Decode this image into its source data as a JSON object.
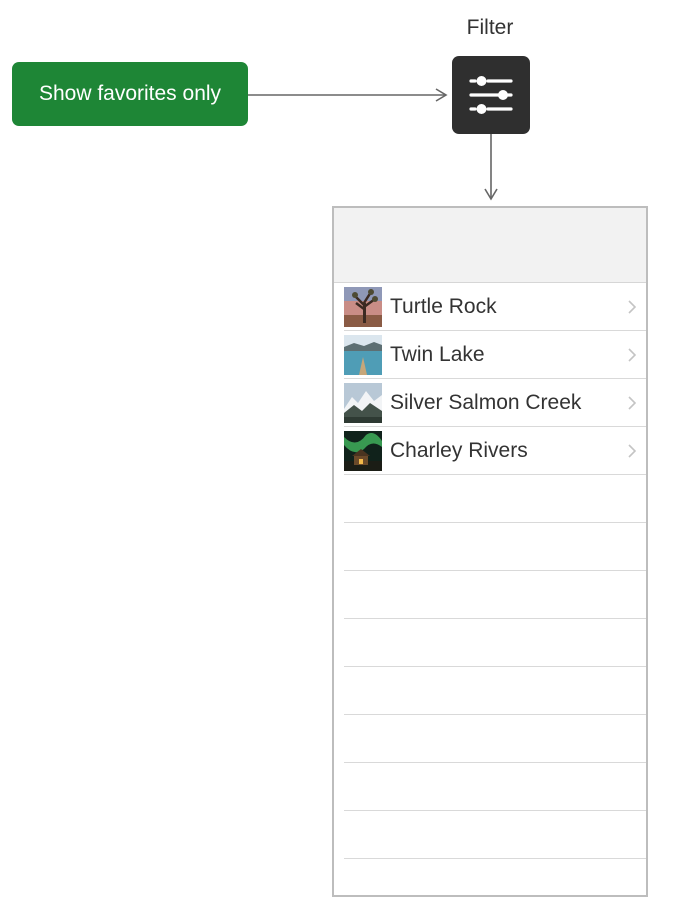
{
  "colors": {
    "accent_green": "#1e8636",
    "filter_bg": "#2f2f2f",
    "connector": "#666666"
  },
  "favorites_button": {
    "label": "Show favorites only"
  },
  "filter": {
    "label": "Filter",
    "icon": "slider-filter-icon"
  },
  "list": {
    "items": [
      {
        "label": "Turtle Rock",
        "thumbnail": "desert-tree-thumbnail"
      },
      {
        "label": "Twin Lake",
        "thumbnail": "lake-dock-thumbnail"
      },
      {
        "label": "Silver Salmon Creek",
        "thumbnail": "snowy-mountains-thumbnail"
      },
      {
        "label": "Charley Rivers",
        "thumbnail": "aurora-cabin-thumbnail"
      }
    ],
    "empty_row_count": 9
  }
}
